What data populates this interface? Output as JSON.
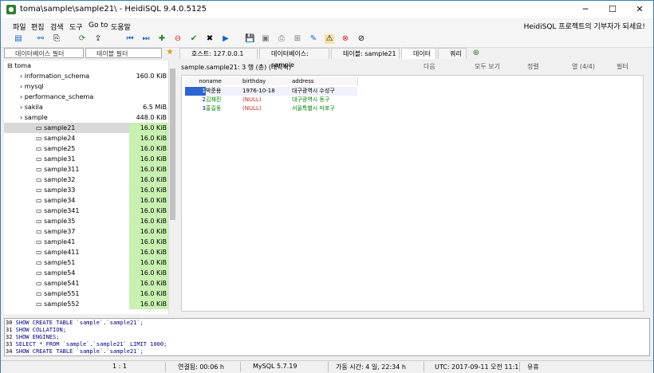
{
  "window": {
    "title": "toma\\sample\\sample21\\ - HeidiSQL 9.4.0.5125"
  },
  "menu": {
    "items": [
      "파일",
      "편집",
      "검색",
      "도구",
      "Go to",
      "도움말"
    ],
    "brand": "HeidiSQL 프로젝트의 기부자가 되세요!"
  },
  "filters": {
    "db_filter": "데이터베이스 필터",
    "table_filter": "테이블 필터"
  },
  "tree": [
    {
      "label": "toma",
      "size": "",
      "level": 0
    },
    {
      "label": "information_schema",
      "size": "160.0 KiB",
      "level": 1
    },
    {
      "label": "mysql",
      "size": "",
      "level": 1
    },
    {
      "label": "performance_schema",
      "size": "",
      "level": 1
    },
    {
      "label": "sakila",
      "size": "6.5 MiB",
      "level": 1
    },
    {
      "label": "sample",
      "size": "448.0 KiB",
      "level": 1
    },
    {
      "label": "sample21",
      "size": "16.0 KiB",
      "level": 2
    },
    {
      "label": "sample24",
      "size": "16.0 KiB",
      "level": 2
    },
    {
      "label": "sample25",
      "size": "16.0 KiB",
      "level": 2
    },
    {
      "label": "sample31",
      "size": "16.0 KiB",
      "level": 2
    },
    {
      "label": "sample311",
      "size": "16.0 KiB",
      "level": 2
    },
    {
      "label": "sample32",
      "size": "16.0 KiB",
      "level": 2
    },
    {
      "label": "sample33",
      "size": "16.0 KiB",
      "level": 2
    },
    {
      "label": "sample34",
      "size": "16.0 KiB",
      "level": 2
    },
    {
      "label": "sample341",
      "size": "16.0 KiB",
      "level": 2
    },
    {
      "label": "sample35",
      "size": "16.0 KiB",
      "level": 2
    },
    {
      "label": "sample37",
      "size": "16.0 KiB",
      "level": 2
    },
    {
      "label": "sample41",
      "size": "16.0 KiB",
      "level": 2
    },
    {
      "label": "sample411",
      "size": "16.0 KiB",
      "level": 2
    },
    {
      "label": "sample51",
      "size": "16.0 KiB",
      "level": 2
    },
    {
      "label": "sample54",
      "size": "16.0 KiB",
      "level": 2
    },
    {
      "label": "sample541",
      "size": "16.0 KiB",
      "level": 2
    },
    {
      "label": "sample551",
      "size": "16.0 KiB",
      "level": 2
    },
    {
      "label": "sample552",
      "size": "16.0 KiB",
      "level": 2
    }
  ],
  "tabs": [
    "호스트: 127.0.0.1",
    "데이터베이스: sample",
    "테이블: sample21",
    "데이터",
    "쿼리"
  ],
  "data": {
    "info": "sample.sample21: 3 행 (총) (대략적)",
    "toolbar": [
      "다음",
      "모두 보기",
      "정렬",
      "열 (4/4)",
      "필터"
    ],
    "columns": [
      "no",
      "name",
      "birthday",
      "address"
    ],
    "rows": [
      [
        "1",
        "박준용",
        "1976-10-18",
        "대구광역시 수성구"
      ],
      [
        "2",
        "김재진",
        "(NULL)",
        "대구광역시 동구"
      ],
      [
        "3",
        "홍길동",
        "(NULL)",
        "서울특별시 마포구"
      ]
    ]
  },
  "query_log": [
    {
      "n": "30",
      "text": "SHOW CREATE TABLE `sample`.`sample21`;"
    },
    {
      "n": "31",
      "text": "SHOW COLLATION;"
    },
    {
      "n": "32",
      "text": "SHOW ENGINES;"
    },
    {
      "n": "33",
      "text": "SELECT * FROM `sample`.`sample21` LIMIT 1000;"
    },
    {
      "n": "34",
      "text": "SHOW CREATE TABLE `sample`.`sample21`;"
    }
  ],
  "status": {
    "cursor": "1 : 1",
    "connected": "연결됨: 00:06 h",
    "server": "MySQL 5.7.19",
    "uptime": "가동 시간: 4 일, 22:34 h",
    "utc": "UTC: 2017-09-11 오전 11:1",
    "state": "유휴"
  },
  "colors": {
    "accent": "#1a5f9e",
    "size_bar": "#c8f0b0",
    "selected_row": "#2f66d1"
  }
}
